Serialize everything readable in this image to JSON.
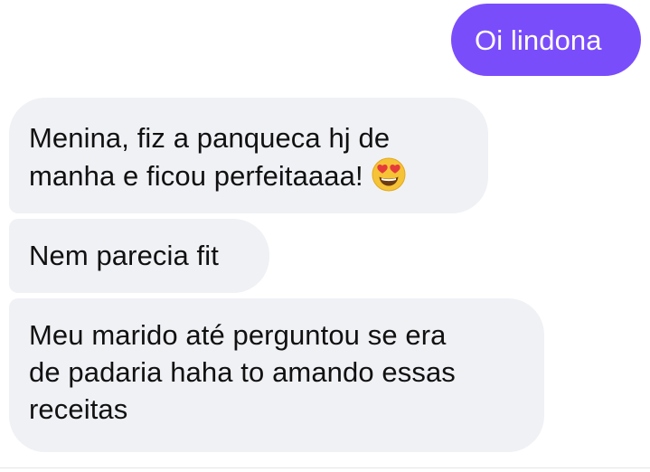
{
  "conversation": {
    "sent_message": "Oi lindona",
    "received": [
      {
        "lines": [
          "Menina, fiz a panqueca hj de",
          "manha e ficou perfeitaaaa!"
        ],
        "emoji": "heart-eyes-emoji"
      },
      {
        "lines": [
          "Nem parecia fit"
        ]
      },
      {
        "lines": [
          "Meu marido até perguntou se era",
          "de padaria haha to amando essas",
          "receitas"
        ]
      }
    ]
  },
  "colors": {
    "sent_bubble": "#7a4dfb",
    "received_bubble": "#f0f1f5",
    "text_dark": "#111111",
    "text_light": "#ffffff"
  }
}
